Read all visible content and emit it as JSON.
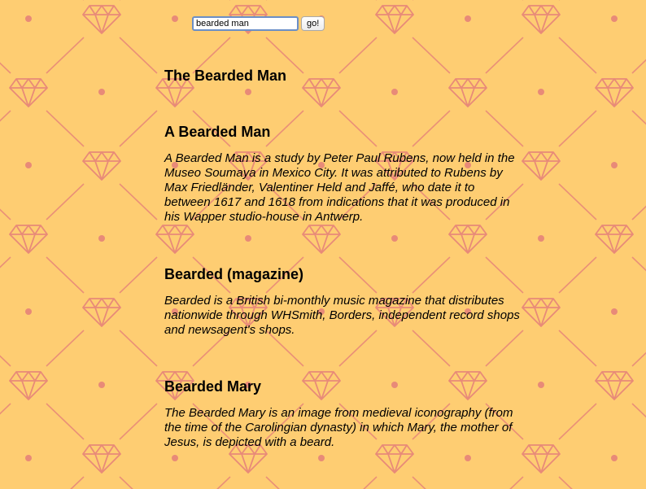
{
  "search": {
    "value": "bearded man",
    "button_label": "go!"
  },
  "page": {
    "title": "The Bearded Man"
  },
  "results": [
    {
      "title": "A Bearded Man",
      "description": "A Bearded Man is a study by Peter Paul Rubens, now held in the Museo Soumaya in Mexico City. It was attributed to Rubens by Max Friedländer, Valentiner Held and Jaffé, who date it to between 1617 and 1618 from indications that it was produced in his Wapper studio-house in Antwerp."
    },
    {
      "title": "Bearded (magazine)",
      "description": "Bearded is a British bi-monthly music magazine that distributes nationwide through WHSmith, Borders, independent record shops and newsagent's shops."
    },
    {
      "title": "Bearded Mary",
      "description": "The Bearded Mary is an image from medieval iconography (from the time of the Carolingian dynasty) in which Mary, the mother of Jesus, is depicted with a beard."
    }
  ],
  "theme": {
    "background": "#fecd72",
    "pattern_color": "#e88a78"
  },
  "background_icon": "diamond-icon"
}
